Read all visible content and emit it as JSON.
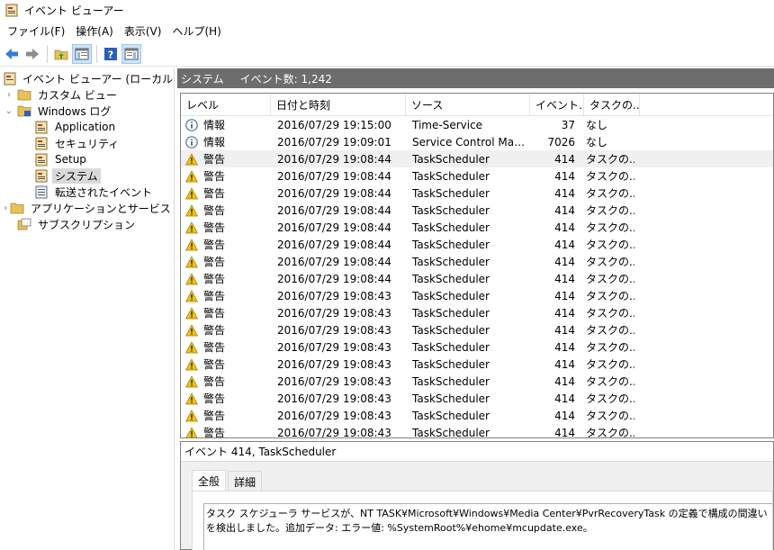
{
  "window": {
    "title": "イベント ビューアー"
  },
  "menu": [
    "ファイル(F)",
    "操作(A)",
    "表示(V)",
    "ヘルプ(H)"
  ],
  "toolbar": {
    "buttons": [
      "back-icon",
      "forward-icon",
      "folder-up-icon",
      "show-tree-icon",
      "help-icon",
      "action-pane-icon"
    ]
  },
  "tree": {
    "root": "イベント ビューアー (ローカル)",
    "custom_views": "カスタム ビュー",
    "windows_logs": "Windows ログ",
    "application": "Application",
    "security": "セキュリティ",
    "setup": "Setup",
    "system": "システム",
    "forwarded": "転送されたイベント",
    "app_service_logs": "アプリケーションとサービス ログ",
    "subscriptions": "サブスクリプション"
  },
  "pane": {
    "title": "システム",
    "count": "イベント数: 1,242"
  },
  "columns": {
    "level": "レベル",
    "date": "日付と時刻",
    "source": "ソース",
    "event_id": "イベント...",
    "task": "タスクの..."
  },
  "rows": [
    {
      "level": "情報",
      "type": "info",
      "date": "2016/07/29 19:15:00",
      "source": "Time-Service",
      "id": "37",
      "task": "なし"
    },
    {
      "level": "情報",
      "type": "info",
      "date": "2016/07/29 19:09:01",
      "source": "Service Control Manager Eventlog Provider",
      "id": "7026",
      "task": "なし"
    },
    {
      "level": "警告",
      "type": "warn",
      "date": "2016/07/29 19:08:44",
      "source": "TaskScheduler",
      "id": "414",
      "task": "タスクの..."
    },
    {
      "level": "警告",
      "type": "warn",
      "date": "2016/07/29 19:08:44",
      "source": "TaskScheduler",
      "id": "414",
      "task": "タスクの..."
    },
    {
      "level": "警告",
      "type": "warn",
      "date": "2016/07/29 19:08:44",
      "source": "TaskScheduler",
      "id": "414",
      "task": "タスクの..."
    },
    {
      "level": "警告",
      "type": "warn",
      "date": "2016/07/29 19:08:44",
      "source": "TaskScheduler",
      "id": "414",
      "task": "タスクの..."
    },
    {
      "level": "警告",
      "type": "warn",
      "date": "2016/07/29 19:08:44",
      "source": "TaskScheduler",
      "id": "414",
      "task": "タスクの..."
    },
    {
      "level": "警告",
      "type": "warn",
      "date": "2016/07/29 19:08:44",
      "source": "TaskScheduler",
      "id": "414",
      "task": "タスクの..."
    },
    {
      "level": "警告",
      "type": "warn",
      "date": "2016/07/29 19:08:44",
      "source": "TaskScheduler",
      "id": "414",
      "task": "タスクの..."
    },
    {
      "level": "警告",
      "type": "warn",
      "date": "2016/07/29 19:08:44",
      "source": "TaskScheduler",
      "id": "414",
      "task": "タスクの..."
    },
    {
      "level": "警告",
      "type": "warn",
      "date": "2016/07/29 19:08:43",
      "source": "TaskScheduler",
      "id": "414",
      "task": "タスクの..."
    },
    {
      "level": "警告",
      "type": "warn",
      "date": "2016/07/29 19:08:43",
      "source": "TaskScheduler",
      "id": "414",
      "task": "タスクの..."
    },
    {
      "level": "警告",
      "type": "warn",
      "date": "2016/07/29 19:08:43",
      "source": "TaskScheduler",
      "id": "414",
      "task": "タスクの..."
    },
    {
      "level": "警告",
      "type": "warn",
      "date": "2016/07/29 19:08:43",
      "source": "TaskScheduler",
      "id": "414",
      "task": "タスクの..."
    },
    {
      "level": "警告",
      "type": "warn",
      "date": "2016/07/29 19:08:43",
      "source": "TaskScheduler",
      "id": "414",
      "task": "タスクの..."
    },
    {
      "level": "警告",
      "type": "warn",
      "date": "2016/07/29 19:08:43",
      "source": "TaskScheduler",
      "id": "414",
      "task": "タスクの..."
    },
    {
      "level": "警告",
      "type": "warn",
      "date": "2016/07/29 19:08:43",
      "source": "TaskScheduler",
      "id": "414",
      "task": "タスクの..."
    },
    {
      "level": "警告",
      "type": "warn",
      "date": "2016/07/29 19:08:43",
      "source": "TaskScheduler",
      "id": "414",
      "task": "タスクの..."
    },
    {
      "level": "警告",
      "type": "warn",
      "date": "2016/07/29 19:08:43",
      "source": "TaskScheduler",
      "id": "414",
      "task": "タスクの..."
    }
  ],
  "details": {
    "title": "イベント 414, TaskScheduler",
    "tabs": [
      "全般",
      "詳細"
    ],
    "description": "タスク スケジューラ サービスが、NT TASK¥Microsoft¥Windows¥Media Center¥PvrRecoveryTask の定義で構成の間違いを検出しました。追加データ: エラー値: %SystemRoot%¥ehome¥mcupdate.exe。"
  },
  "colors": {
    "header_bg": "#6d6d6d",
    "warn": "#f4c20d",
    "info_ring": "#4a6fa5",
    "selected": "#d9d9d9"
  }
}
